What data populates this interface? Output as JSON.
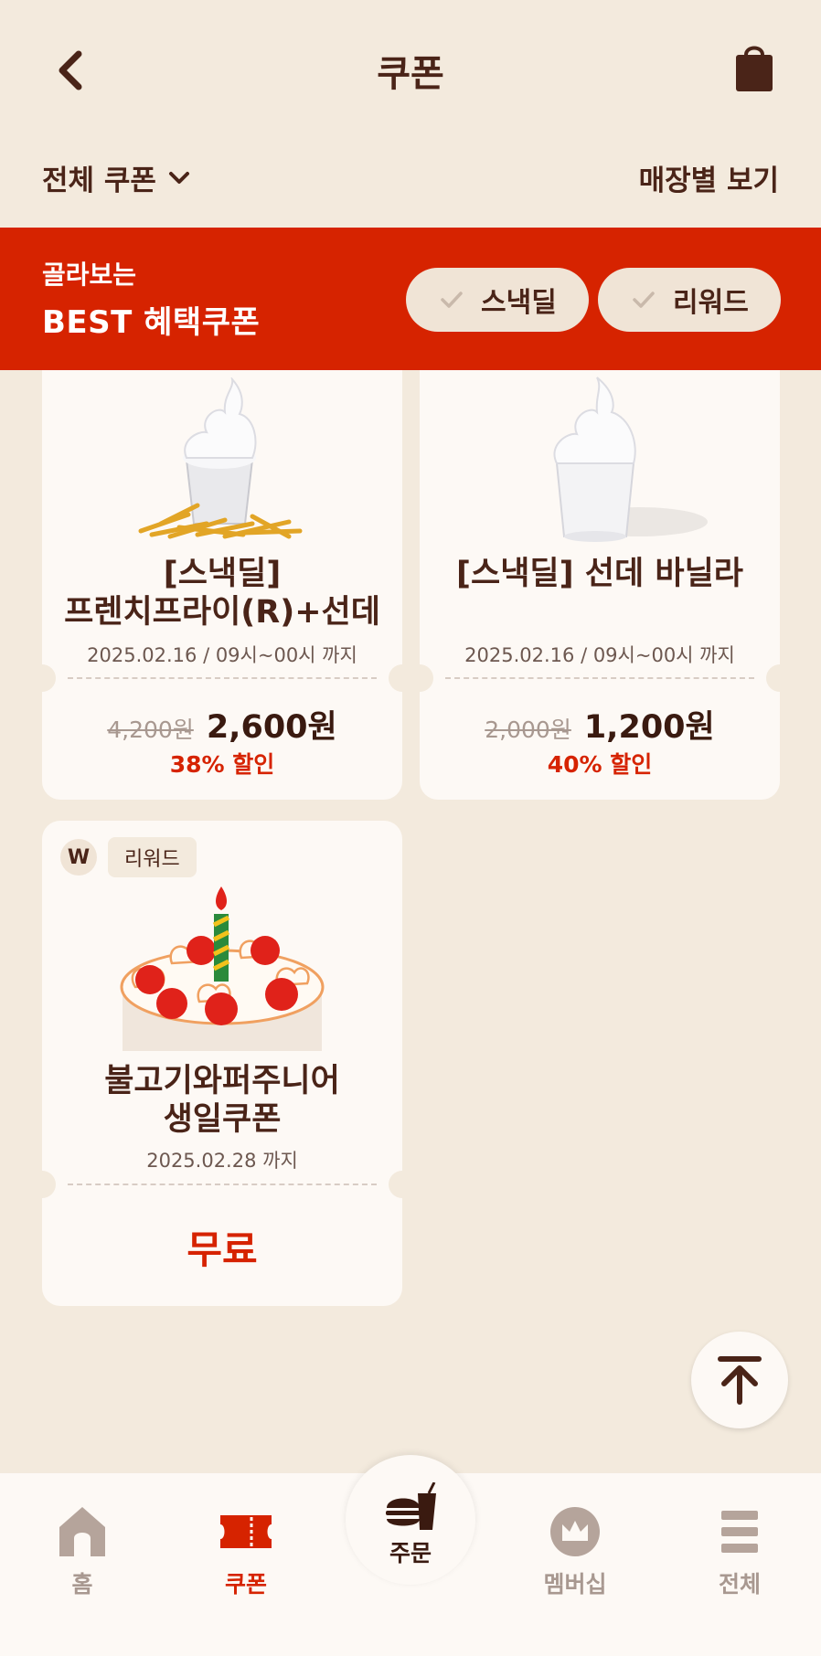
{
  "header": {
    "title": "쿠폰"
  },
  "filter": {
    "dropdown_label": "전체 쿠폰",
    "store_view_label": "매장별 보기"
  },
  "banner": {
    "subtitle": "골라보는",
    "title": "BEST 혜택쿠폰",
    "chips": [
      "스낵딜",
      "리워드"
    ]
  },
  "coupons": [
    {
      "title_line1": "[스낵딜]",
      "title_line2": "프렌치프라이(R)+선데",
      "date": "2025.02.16 / 09시~00시 까지",
      "original_price": "4,200원",
      "price": "2,600원",
      "discount": "38% 할인"
    },
    {
      "title_line1": "[스낵딜] 선데 바닐라",
      "date": "2025.02.16 / 09시~00시 까지",
      "original_price": "2,000원",
      "price": "1,200원",
      "discount": "40% 할인"
    },
    {
      "badge_letter": "W",
      "badge_label": "리워드",
      "title_line1": "불고기와퍼주니어",
      "title_line2": "생일쿠폰",
      "date": "2025.02.28 까지",
      "free_label": "무료"
    }
  ],
  "bottom_nav": {
    "items": [
      "홈",
      "쿠폰",
      "주문",
      "멤버십",
      "전체"
    ],
    "active": "쿠폰"
  },
  "colors": {
    "brand_red": "#d62300",
    "brown": "#4a2418",
    "background": "#f3eadd"
  }
}
